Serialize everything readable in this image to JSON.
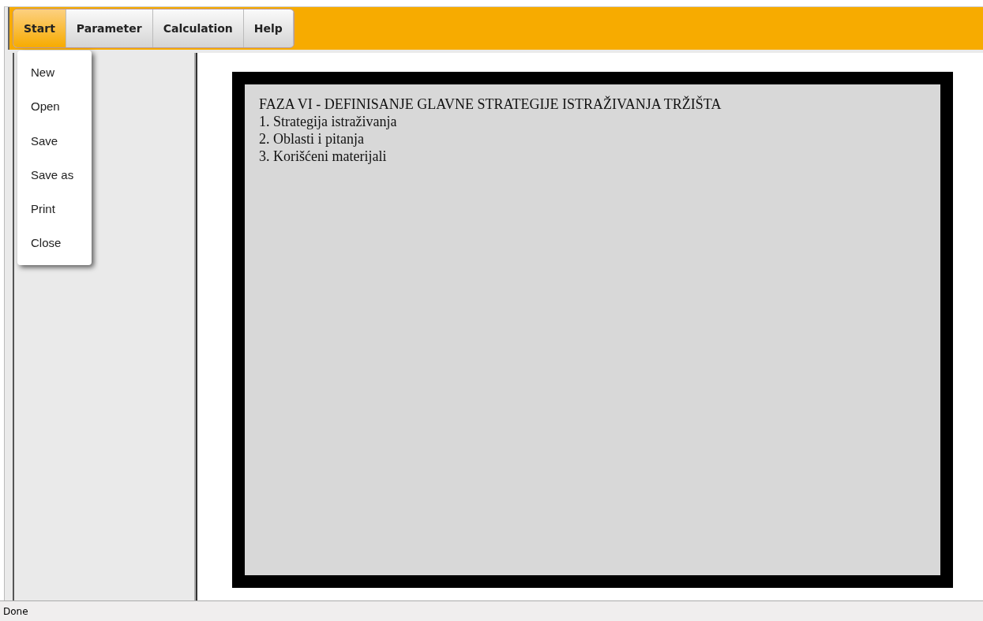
{
  "menu_bar": {
    "tabs": [
      {
        "label": "Start",
        "selected": true
      },
      {
        "label": "Parameter",
        "selected": false
      },
      {
        "label": "Calculation",
        "selected": false
      },
      {
        "label": "Help",
        "selected": false
      }
    ]
  },
  "dropdown": {
    "items": [
      "New",
      "Open",
      "Save",
      "Save as",
      "Print",
      "Close"
    ]
  },
  "document": {
    "title": "FAZA VI - DEFINISANJE GLAVNE STRATEGIJE ISTRAŽIVANJA TRŽIŠTA",
    "lines": [
      "1. Strategija istraživanja",
      "2. Oblasti i pitanja",
      "3. Korišćeni materijali"
    ]
  },
  "status_bar": {
    "text": "Done"
  }
}
